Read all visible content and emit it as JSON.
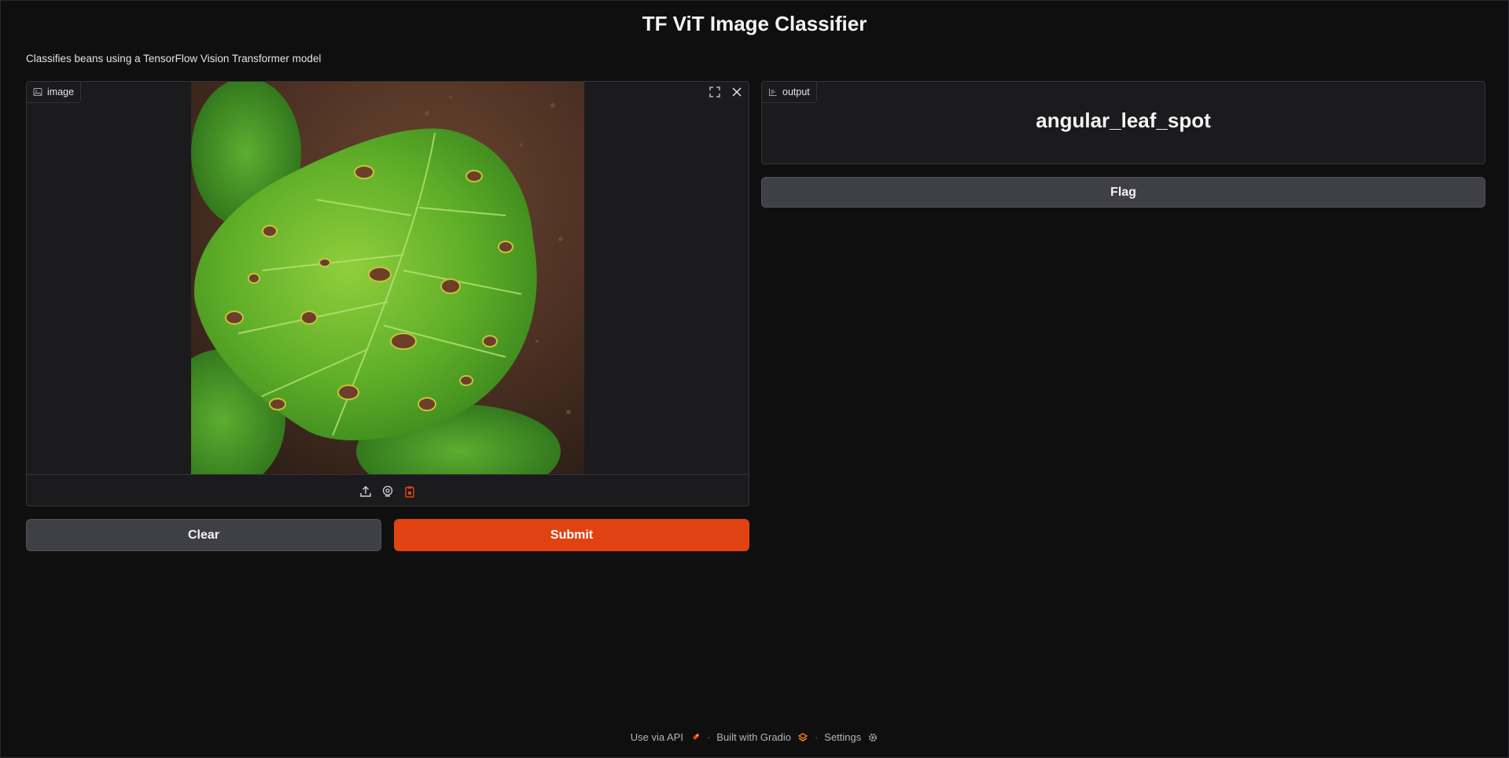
{
  "header": {
    "title": "TF ViT Image Classifier",
    "description": "Classifies beans using a TensorFlow Vision Transformer model"
  },
  "input": {
    "label": "image",
    "image_alt": "bean leaf with angular leaf spot"
  },
  "output": {
    "label": "output",
    "value": "angular_leaf_spot"
  },
  "buttons": {
    "clear": "Clear",
    "submit": "Submit",
    "flag": "Flag"
  },
  "footer": {
    "api": "Use via API",
    "built": "Built with Gradio",
    "settings": "Settings",
    "separator": "·"
  },
  "colors": {
    "accent": "#e04311",
    "background": "#0f0f10",
    "panel": "#1b1b1e"
  }
}
